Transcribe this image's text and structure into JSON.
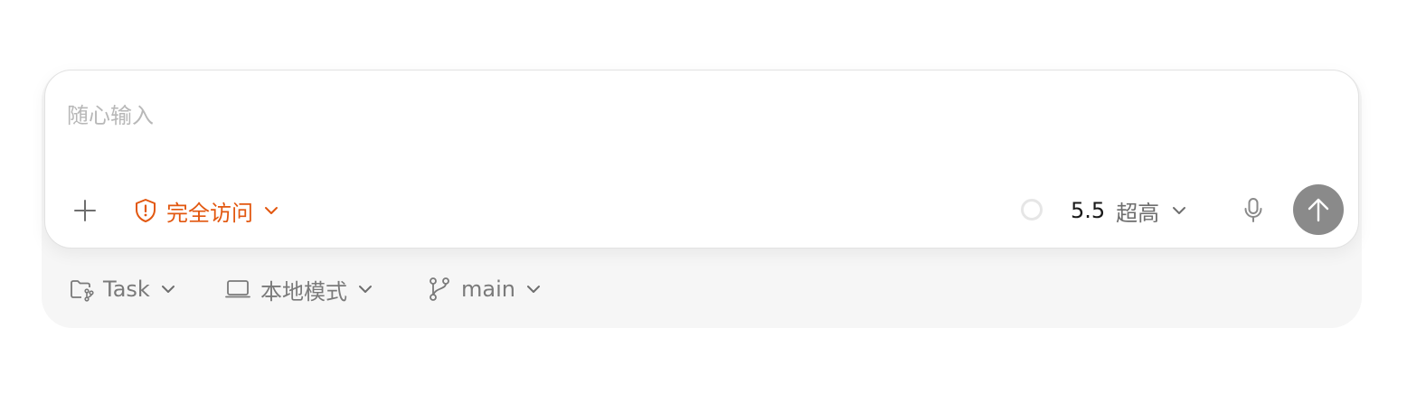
{
  "composer": {
    "placeholder": "随心输入",
    "access_label": "完全访问",
    "model_version": "5.5",
    "model_level": "超高",
    "accent_color": "#e2570f",
    "send_button_color": "#8a8a8a",
    "icons": {
      "add": "plus-icon",
      "access": "shield-alert-icon",
      "status": "circle-status-icon",
      "mic": "microphone-icon",
      "send": "arrow-up-icon"
    }
  },
  "footer": {
    "project_label": "Task",
    "mode_label": "本地模式",
    "branch_label": "main",
    "icons": {
      "project": "folder-branch-icon",
      "mode": "laptop-icon",
      "branch": "git-branch-icon"
    }
  }
}
